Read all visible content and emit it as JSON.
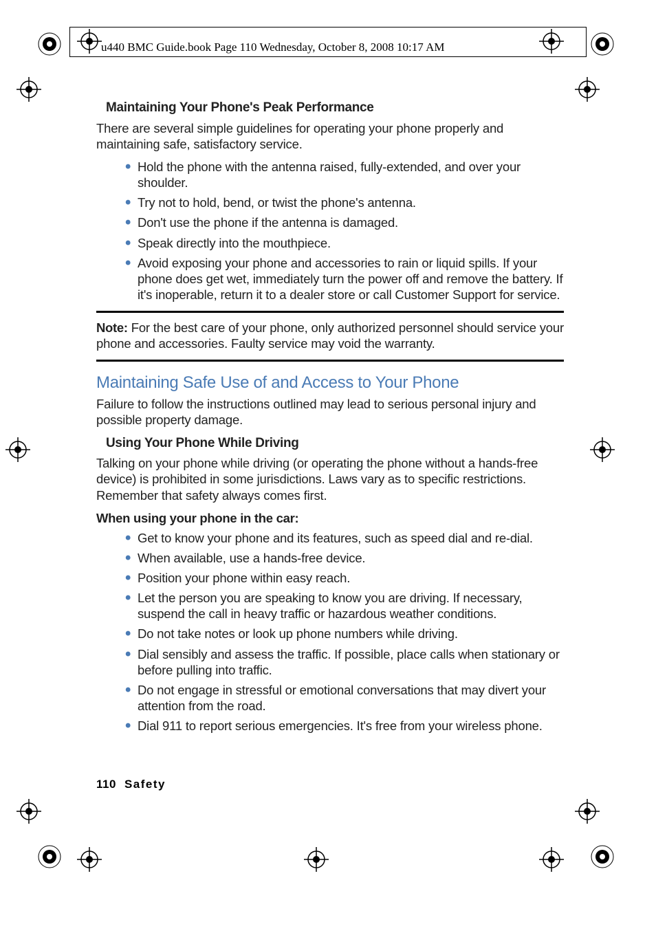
{
  "header": "u440 BMC Guide.book  Page 110  Wednesday, October 8, 2008  10:17 AM",
  "sub1_title": "Maintaining Your Phone's Peak Performance",
  "sub1_para": "There are several simple guidelines for operating your phone properly and maintaining safe, satisfactory service.",
  "list1": [
    "Hold the phone with the antenna raised, fully-extended, and over your shoulder.",
    "Try not to hold, bend, or twist the phone's antenna.",
    "Don't use the phone if the antenna is damaged.",
    "Speak directly into the mouthpiece.",
    "Avoid exposing your phone and accessories to rain or liquid spills. If your phone does get wet, immediately turn the power off and remove the battery. If it's inoperable, return it to a dealer store or call Customer Support for service."
  ],
  "note_label": "Note:",
  "note_text": " For the best care of your phone, only authorized personnel should service your phone and accessories. Faulty service may void the warranty.",
  "section2_title": "Maintaining Safe Use of and Access to Your Phone",
  "section2_para": "Failure to follow the instructions outlined may lead to serious personal injury and possible property damage.",
  "sub2_title": "Using Your Phone While Driving",
  "sub2_para": "Talking on your phone while driving (or operating the phone without a hands-free device) is prohibited in some jurisdictions. Laws vary as to specific restrictions. Remember that safety always comes first.",
  "bold_line": "When using your phone in the car:",
  "list2": [
    "Get to know your phone and its features, such as speed dial and re-dial.",
    "When available, use a hands-free device.",
    "Position your phone within easy reach.",
    "Let the person you are speaking to know you are driving. If necessary, suspend the call in heavy traffic or hazardous weather conditions.",
    "Do not take notes or look up phone numbers while driving.",
    "Dial sensibly and assess the traffic. If possible, place calls when stationary or before pulling into traffic.",
    "Do not engage in stressful or emotional conversations that may divert your attention from the road.",
    "Dial 911 to report serious emergencies. It's free from your wireless phone."
  ],
  "footer_page": "110",
  "footer_section": "Safety"
}
